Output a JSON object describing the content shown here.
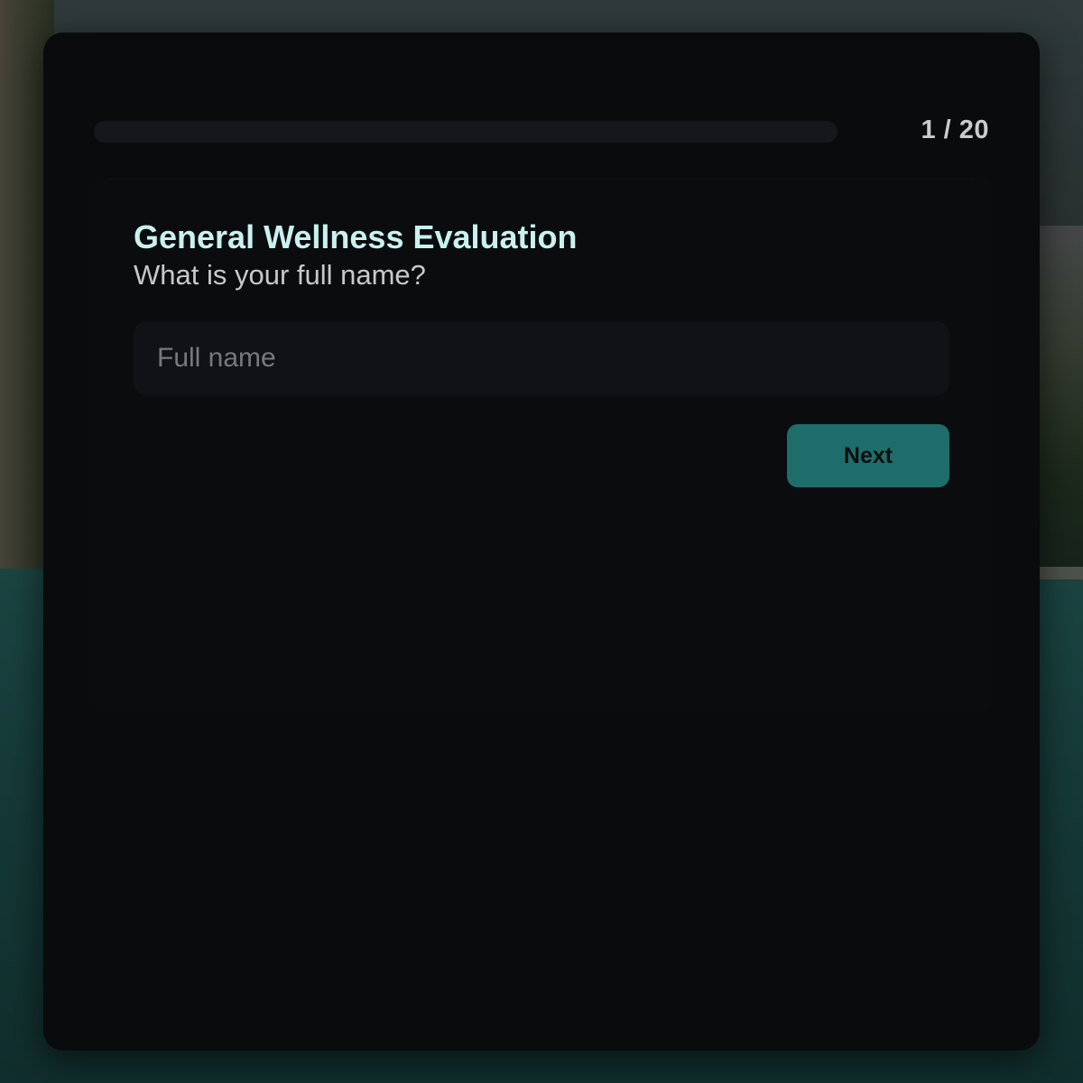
{
  "progress": {
    "counter": "1 / 20",
    "current": 1,
    "total": 20,
    "fraction_complete": 0
  },
  "form": {
    "title": "General Wellness Evaluation",
    "question": "What is your full name?",
    "name_input": {
      "value": "",
      "placeholder": "Full name"
    },
    "next_label": "Next"
  },
  "colors": {
    "accent": "#1e6d6a",
    "title": "#c9f1ef",
    "panel_background": "#0a0b0d"
  }
}
